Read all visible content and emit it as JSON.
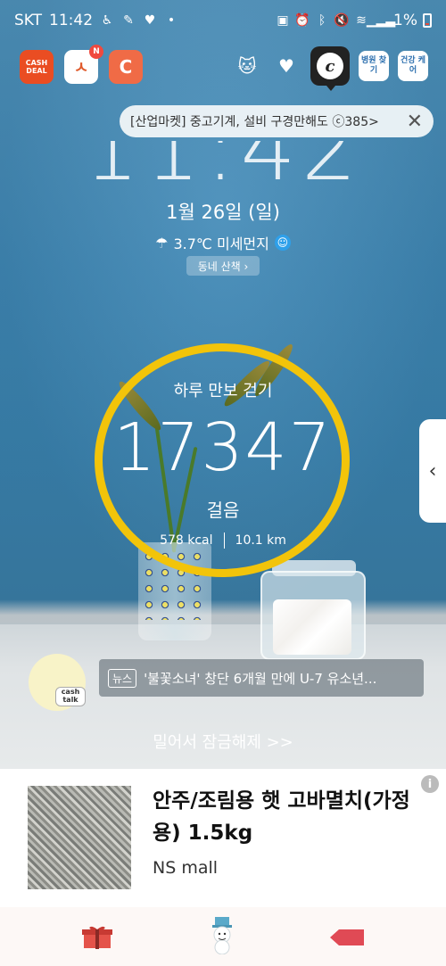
{
  "status_bar": {
    "carrier": "SKT",
    "time": "11:42",
    "battery": "1%"
  },
  "apps": {
    "cashdeal_label": "CASH DEAL",
    "mall_label": "ㅅ",
    "mall_badge": "N",
    "pet_label": "C",
    "hospital_label": "병원 찾기",
    "health_label": "건강 케어"
  },
  "notification": {
    "text": "[산업마켓] 중고기계, 설비 구경만해도 ⓒ385>"
  },
  "clock": {
    "time": "11:42",
    "date": "1월 26일 (일)",
    "weather": "3.7℃ 미세먼지",
    "walk_button": "동네 산책 ›"
  },
  "pedometer": {
    "title": "하루 만보 걷기",
    "steps": "17347",
    "steps_label": "걸음",
    "kcal": "578 kcal",
    "distance": "10.1 km"
  },
  "news": {
    "tag": "뉴스",
    "headline": "'불꽃소녀' 창단 6개월 만에 U-7 유소년...",
    "cashtalk_label": "cash talk"
  },
  "unlock": {
    "label": "밀어서 잠금해제 >>"
  },
  "ad": {
    "title": "안주/조림용 햇 고바멸치(가정용) 1.5kg",
    "source": "NS mall",
    "info_icon": "i"
  },
  "colors": {
    "ring": "#f2c40a",
    "accent_red": "#ea4d22"
  }
}
